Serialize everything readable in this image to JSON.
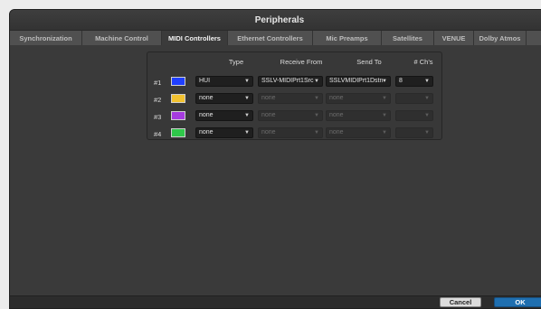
{
  "window": {
    "title": "Peripherals"
  },
  "tabs": [
    {
      "label": "Synchronization"
    },
    {
      "label": "Machine Control"
    },
    {
      "label": "MIDI Controllers"
    },
    {
      "label": "Ethernet Controllers"
    },
    {
      "label": "Mic Preamps"
    },
    {
      "label": "Satellites"
    },
    {
      "label": "VENUE"
    },
    {
      "label": "Dolby Atmos"
    }
  ],
  "active_tab": "MIDI Controllers",
  "columns": {
    "type": "Type",
    "receive_from": "Receive From",
    "send_to": "Send To",
    "channels": "# Ch's"
  },
  "rows": [
    {
      "label": "#1",
      "color": "#1f3fff",
      "type": "HUI",
      "receive_from": "SSLV-MIDIPrt1Src",
      "send_to": "SSLVMIDIPrt1Dstn",
      "channels": "8",
      "enabled": true
    },
    {
      "label": "#2",
      "color": "#f2c230",
      "type": "none",
      "receive_from": "none",
      "send_to": "none",
      "channels": "",
      "enabled": false
    },
    {
      "label": "#3",
      "color": "#a63be0",
      "type": "none",
      "receive_from": "none",
      "send_to": "none",
      "channels": "",
      "enabled": false
    },
    {
      "label": "#4",
      "color": "#2fc84a",
      "type": "none",
      "receive_from": "none",
      "send_to": "none",
      "channels": "",
      "enabled": false
    }
  ],
  "buttons": {
    "cancel": "Cancel",
    "ok": "OK"
  }
}
